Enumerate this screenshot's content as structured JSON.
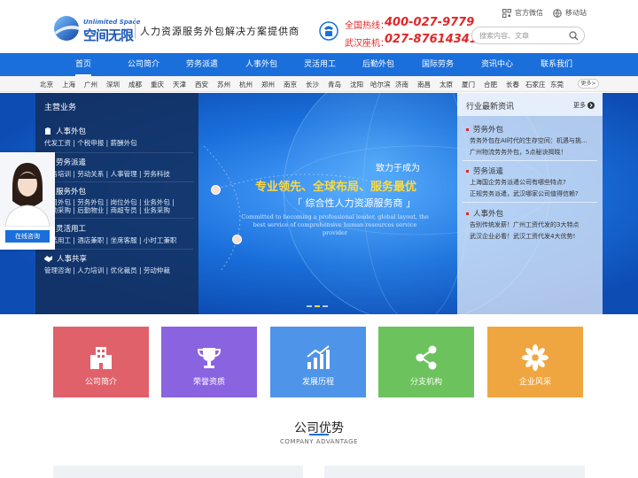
{
  "brand": {
    "logo_en": "Unlimited Space",
    "logo_cn": "空间无限",
    "slogan": "人力资源服务外包解决方案提供商",
    "accent": "#1a6fdb",
    "hotline_color": "#e02727"
  },
  "contact": {
    "hot_label": "全国热线：",
    "hot_number": "400-027-9779",
    "seat_label": "武汉座机：",
    "seat_number": "027-87614341"
  },
  "top_links": {
    "wechat": "官方微信",
    "mobile": "移动站"
  },
  "search": {
    "placeholder": "搜索内容、文章"
  },
  "nav": {
    "items": [
      "首页",
      "公司简介",
      "劳务派遣",
      "人事外包",
      "灵活用工",
      "后勤外包",
      "国际劳务",
      "资讯中心",
      "联系我们"
    ],
    "active": "首页"
  },
  "cities": {
    "items": [
      "北京",
      "上海",
      "广州",
      "深圳",
      "成都",
      "重庆",
      "天津",
      "西安",
      "苏州",
      "杭州",
      "郑州",
      "南京",
      "长沙",
      "青岛",
      "沈阳",
      "哈尔滨",
      "济南",
      "南昌",
      "太原",
      "厦门",
      "合肥",
      "长春",
      "石家庄",
      "东莞"
    ],
    "more": "更多>"
  },
  "services": {
    "title": "主营业务",
    "groups": [
      {
        "name": "人事外包",
        "links": "代发工资 | 个税申报 | 薪酬外包"
      },
      {
        "name": "劳务派遣",
        "links": "劳务培训 | 劳动关系 | 人事管理 | 劳务科技"
      },
      {
        "name": "服务外包",
        "links": "项目外包 | 劳务外包 | 岗位外包 | 业务外包 | 后勤采购 | 后勤物业 | 商超专员 | 业务采购"
      },
      {
        "name": "灵活用工",
        "links": "日结用工 | 酒店兼职 | 坐席客服 | 小时工兼职"
      },
      {
        "name": "人事共享",
        "links": "管理咨询 | 人力培训 | 优化裁员 | 劳动仲裁"
      }
    ]
  },
  "banner": {
    "line1": "致力于成为",
    "line2": "专业领先、全球布局、服务最优",
    "line3": "「 综合性人力资源服务商 」",
    "english": "Committed to becoming a professional leader, global layout, the best service of comprehensive human resources service provider",
    "slide_count": 3,
    "active_slide": 2
  },
  "news": {
    "title": "行业最新资讯",
    "more": "更多",
    "categories": [
      {
        "name": "劳务外包",
        "items": [
          "劳务外包在AI时代的生存空间：机遇与挑...",
          "广州物流劳务外包，5点秘诀揭晓！"
        ]
      },
      {
        "name": "劳务派遣",
        "items": [
          "上海国企劳务派遣公司有哪些特点?",
          "正规劳务派遣，武汉哪家公司值得信赖?"
        ]
      },
      {
        "name": "人事外包",
        "items": [
          "告别传统发薪！广州工资代发的3大特点",
          "武汉企业必看！武汉工资代发4大优势!"
        ]
      }
    ]
  },
  "consult": {
    "button": "在线咨询"
  },
  "tiles": [
    {
      "label": "公司简介",
      "color": "#e0616a",
      "icon": "building-icon"
    },
    {
      "label": "荣誉资质",
      "color": "#8a63e0",
      "icon": "trophy-icon"
    },
    {
      "label": "发展历程",
      "color": "#4e94e8",
      "icon": "growth-chart-icon"
    },
    {
      "label": "分支机构",
      "color": "#6cc25c",
      "icon": "share-nodes-icon"
    },
    {
      "label": "企业风采",
      "color": "#f0a640",
      "icon": "flower-icon"
    }
  ],
  "advantage": {
    "title": "公司优势",
    "subtitle": "COMPANY ADVANTAGE"
  }
}
